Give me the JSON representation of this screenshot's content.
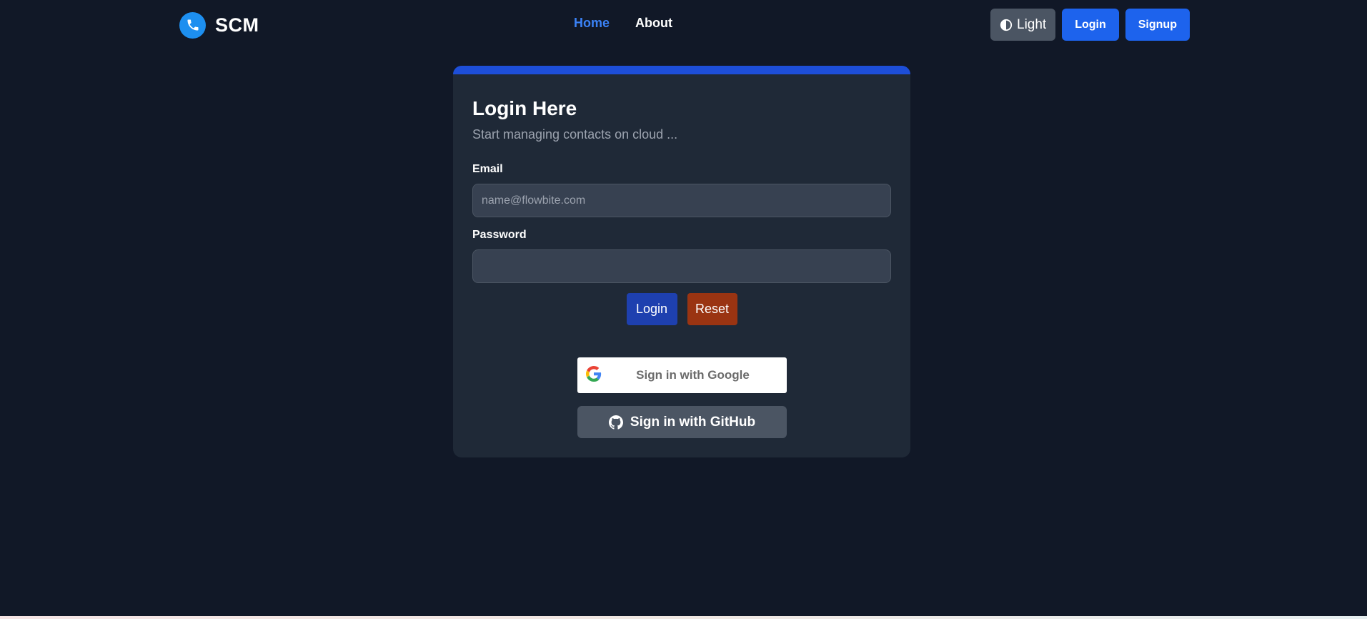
{
  "navbar": {
    "brand": {
      "name": "SCM",
      "icon": "phone-icon"
    },
    "links": [
      {
        "label": "Home",
        "active": true
      },
      {
        "label": "About",
        "active": false
      }
    ],
    "theme_toggle": {
      "label": "Light",
      "icon": "contrast-icon"
    },
    "login_label": "Login",
    "signup_label": "Signup"
  },
  "login_card": {
    "title": "Login Here",
    "subtitle": "Start managing contacts on cloud ...",
    "email": {
      "label": "Email",
      "placeholder": "name@flowbite.com",
      "value": ""
    },
    "password": {
      "label": "Password",
      "placeholder": "",
      "value": ""
    },
    "login_button": "Login",
    "reset_button": "Reset",
    "google_button": {
      "label": "Sign in with Google",
      "icon": "google-icon"
    },
    "github_button": {
      "label": "Sign in with GitHub",
      "icon": "github-icon"
    }
  },
  "colors": {
    "background": "#111827",
    "card": "#1f2937",
    "card_accent": "#1d4ed8",
    "primary": "#1d63ed",
    "active_link": "#3b82f6",
    "reset": "#9a3412",
    "login_submit": "#1e40af"
  }
}
